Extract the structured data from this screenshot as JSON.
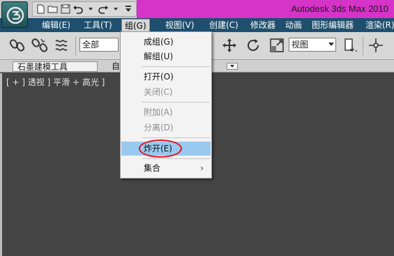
{
  "window": {
    "title": "Autodesk 3ds Max  2010"
  },
  "quick_access": {
    "icons": [
      "new-file-icon",
      "open-folder-icon",
      "save-icon",
      "undo-icon",
      "redo-icon",
      "customize-icon"
    ]
  },
  "menubar": {
    "items": [
      {
        "label": "编辑(E)"
      },
      {
        "label": "工具(T)"
      },
      {
        "label": "组(G)"
      },
      {
        "label": "视图(V)"
      },
      {
        "label": "创建(C)"
      },
      {
        "label": "修改器"
      },
      {
        "label": "动画"
      },
      {
        "label": "图形编辑器"
      },
      {
        "label": "渲染(R)"
      }
    ]
  },
  "toolbar": {
    "selection_filter": "全部",
    "reference_coord": "视图"
  },
  "ribbon": {
    "tabs": [
      {
        "label": "石墨建模工具"
      },
      {
        "label": "自"
      }
    ]
  },
  "viewport": {
    "label": "[ + ] 透视 ] 平滑 + 高光 ]"
  },
  "group_menu": {
    "items": [
      {
        "label": "成组(G)"
      },
      {
        "label": "解组(U)"
      },
      {
        "label": "打开(O)"
      },
      {
        "label": "关闭(C)"
      },
      {
        "label": "附加(A)"
      },
      {
        "label": "分离(D)"
      },
      {
        "label": "炸开(E)"
      },
      {
        "label": "集合"
      }
    ],
    "submenu_arrow": "›"
  },
  "colors": {
    "title_accent": "#d633c8",
    "menubar": "#1e4f6f",
    "highlight": "#99c9ef",
    "annotation": "#e0161f"
  }
}
